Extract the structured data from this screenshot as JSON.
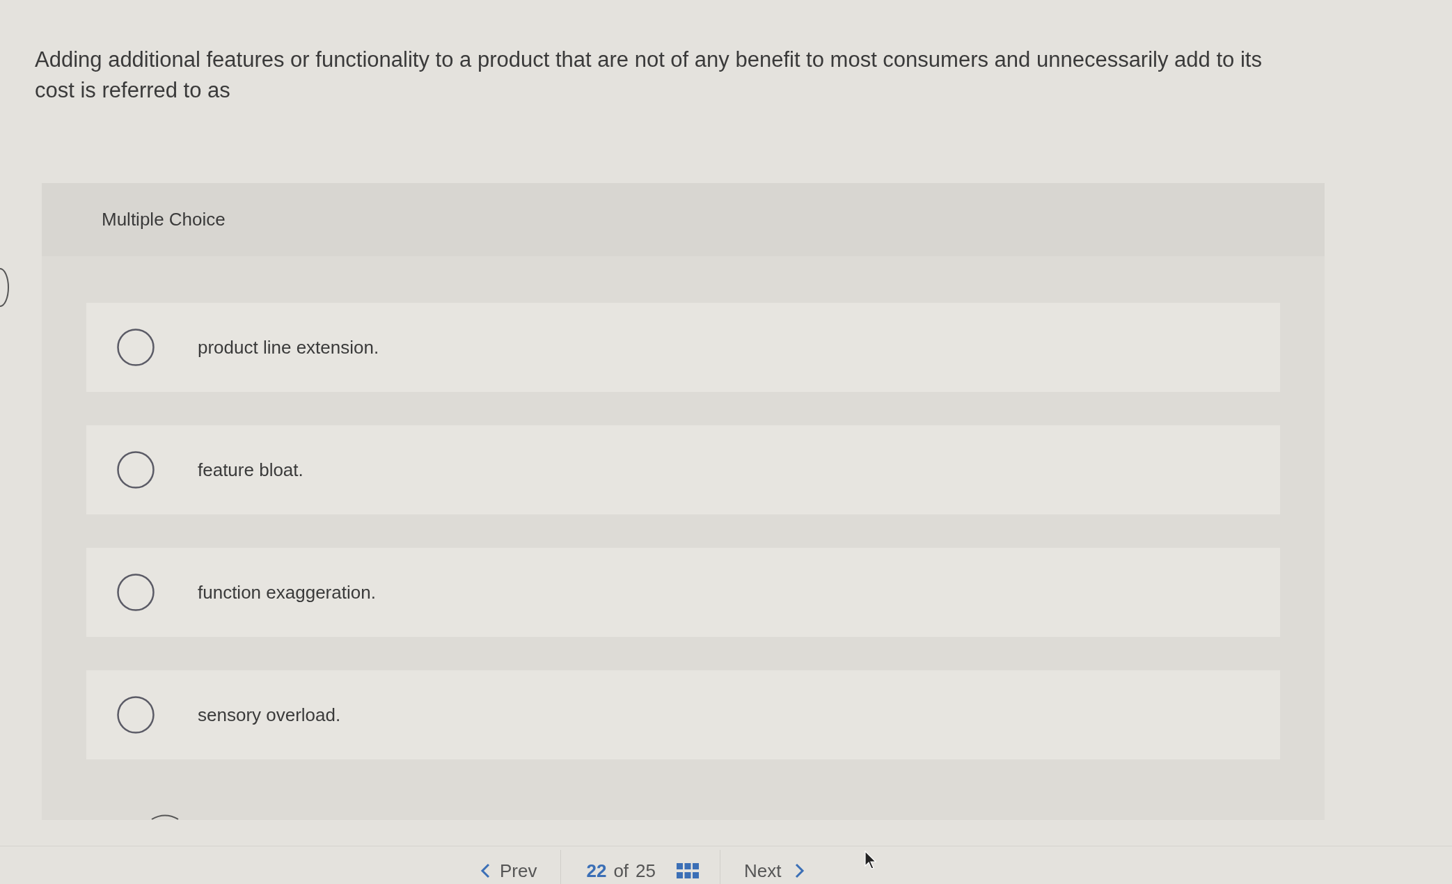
{
  "question": "Adding additional features or functionality to a product that are not of any benefit to most consumers and unnecessarily add to its cost is referred to as",
  "question_type": "Multiple Choice",
  "options": [
    {
      "label": "product line extension.",
      "selected": false
    },
    {
      "label": "feature bloat.",
      "selected": false
    },
    {
      "label": "function exaggeration.",
      "selected": false
    },
    {
      "label": "sensory overload.",
      "selected": false
    }
  ],
  "navigation": {
    "prev": "Prev",
    "current": "22",
    "of": "of",
    "total": "25",
    "next": "Next"
  }
}
